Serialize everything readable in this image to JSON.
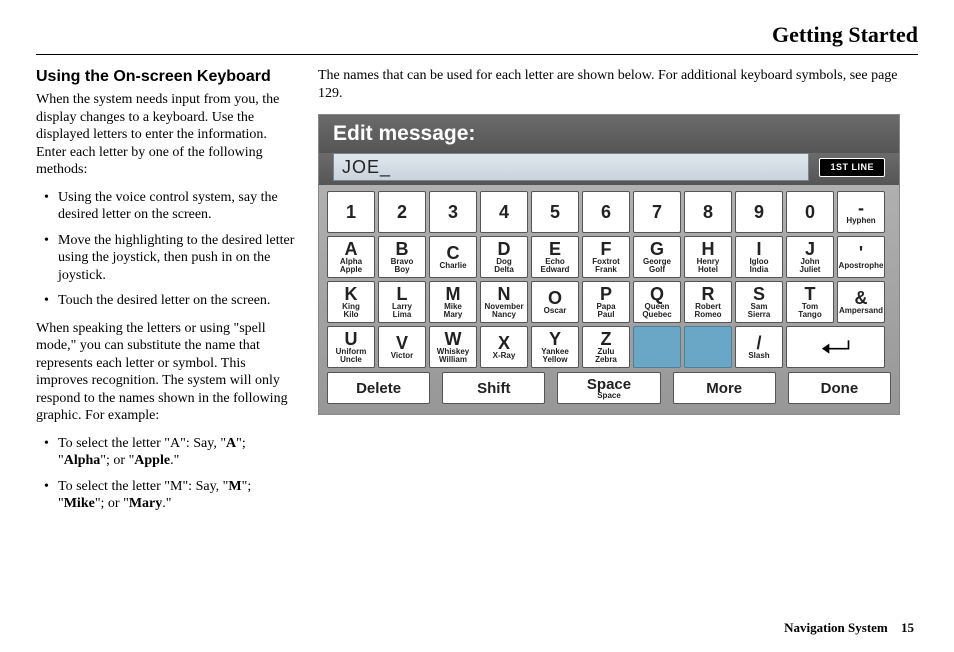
{
  "header": {
    "title": "Getting Started"
  },
  "left": {
    "heading": "Using the On-screen Keyboard",
    "p1": "When the system needs input from you, the display changes to a keyboard. Use the displayed letters to enter the information. Enter each letter by one of the following methods:",
    "methods": [
      "Using the voice control system, say the desired letter on the screen.",
      "Move the highlighting to the desired letter using the joystick, then push in on the joystick.",
      "Touch the desired letter on the screen."
    ],
    "p2": "When speaking the letters or using \"spell mode,\" you can substitute the name that represents each letter or symbol. This improves recognition. The system will only respond to the names shown in the following graphic. For example:",
    "examples_raw": [
      "To select the letter \"A\": Say, \"<b>A</b>\"; \"<b>Alpha</b>\"; or \"<b>Apple</b>.\"",
      "To select the letter \"M\": Say, \"<b>M</b>\"; \"<b>Mike</b>\"; or \"<b>Mary</b>.\""
    ]
  },
  "right": {
    "intro": "The names that can be used for each letter are shown below. For additional keyboard symbols, see page 129."
  },
  "keyboard": {
    "title": "Edit message:",
    "input_value": "JOE_",
    "badge": "1ST LINE",
    "num_row": [
      {
        "big": "1"
      },
      {
        "big": "2"
      },
      {
        "big": "3"
      },
      {
        "big": "4"
      },
      {
        "big": "5"
      },
      {
        "big": "6"
      },
      {
        "big": "7"
      },
      {
        "big": "8"
      },
      {
        "big": "9"
      },
      {
        "big": "0"
      },
      {
        "big": "-",
        "sm": "Hyphen"
      }
    ],
    "rowA": [
      {
        "big": "A",
        "sm": "Alpha\nApple"
      },
      {
        "big": "B",
        "sm": "Bravo\nBoy"
      },
      {
        "big": "C",
        "sm": "Charlie"
      },
      {
        "big": "D",
        "sm": "Dog\nDelta"
      },
      {
        "big": "E",
        "sm": "Echo\nEdward"
      },
      {
        "big": "F",
        "sm": "Foxtrot\nFrank"
      },
      {
        "big": "G",
        "sm": "George\nGolf"
      },
      {
        "big": "H",
        "sm": "Henry\nHotel"
      },
      {
        "big": "I",
        "sm": "Igloo\nIndia"
      },
      {
        "big": "J",
        "sm": "John\nJuliet"
      },
      {
        "big": "'",
        "sm": "Apostrophe"
      }
    ],
    "rowK": [
      {
        "big": "K",
        "sm": "King\nKilo"
      },
      {
        "big": "L",
        "sm": "Larry\nLima"
      },
      {
        "big": "M",
        "sm": "Mike\nMary"
      },
      {
        "big": "N",
        "sm": "November\nNancy"
      },
      {
        "big": "O",
        "sm": "Oscar"
      },
      {
        "big": "P",
        "sm": "Papa\nPaul"
      },
      {
        "big": "Q",
        "sm": "Queen\nQuebec"
      },
      {
        "big": "R",
        "sm": "Robert\nRomeo"
      },
      {
        "big": "S",
        "sm": "Sam\nSierra"
      },
      {
        "big": "T",
        "sm": "Tom\nTango"
      },
      {
        "big": "&",
        "sm": "Ampersand"
      }
    ],
    "rowU": [
      {
        "big": "U",
        "sm": "Uniform\nUncle"
      },
      {
        "big": "V",
        "sm": "Victor"
      },
      {
        "big": "W",
        "sm": "Whiskey\nWilliam"
      },
      {
        "big": "X",
        "sm": "X-Ray"
      },
      {
        "big": "Y",
        "sm": "Yankee\nYellow"
      },
      {
        "big": "Z",
        "sm": "Zulu\nZebra"
      },
      {
        "blank": true
      },
      {
        "blank": true
      },
      {
        "big": "/",
        "sm": "Slash"
      },
      {
        "enter": true
      }
    ],
    "controls": [
      {
        "lab": "Delete"
      },
      {
        "lab": "Shift"
      },
      {
        "lab": "Space",
        "sub": "Space"
      },
      {
        "lab": "More"
      },
      {
        "lab": "Done"
      }
    ]
  },
  "footer": {
    "label": "Navigation System",
    "page": "15"
  }
}
